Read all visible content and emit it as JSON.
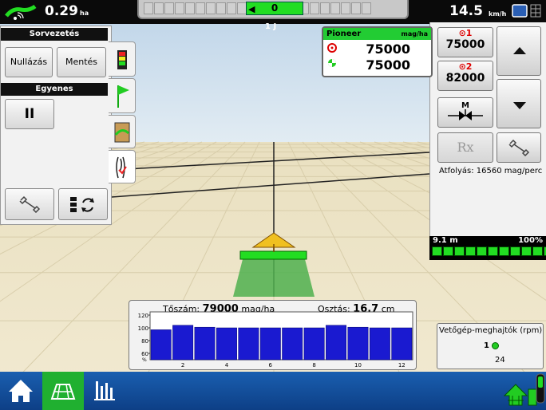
{
  "topbar": {
    "area_value": "0.29",
    "area_unit": "ha",
    "guidance_offset": "0",
    "pass_number": "1 J",
    "speed_value": "14.5",
    "speed_unit": "km/h"
  },
  "steering_panel": {
    "header": "Sorvezetés",
    "reset_label": "Nullázás",
    "save_label": "Mentés",
    "pattern_header": "Egyenes",
    "pause_label": "II"
  },
  "tabs": [
    "lightbar-tab-icon",
    "flag-tab-icon",
    "field-tab-icon",
    "steering-tab-icon"
  ],
  "product": {
    "name": "Pioneer",
    "unit": "mag/ha",
    "target_rate": "75000",
    "actual_rate": "75000"
  },
  "rate_presets": [
    {
      "label": "⊙1",
      "value": "75000"
    },
    {
      "label": "⊙2",
      "value": "82000"
    }
  ],
  "manual_label": "M",
  "rx_label": "Rx",
  "flow": "Átfolyás: 16560 mag/perc",
  "boom": {
    "width": "9.1 m",
    "percent": "100%",
    "sections": 12
  },
  "population_chart": {
    "population_label": "Tőszám:",
    "population_value": "79000",
    "population_unit": "mag/ha",
    "spacing_label": "Osztás:",
    "spacing_value": "16.7",
    "spacing_unit": "cm",
    "y_ticks": [
      "120",
      "100",
      "80",
      "60"
    ],
    "y_unit": "%",
    "x_ticks": [
      "2",
      "4",
      "6",
      "8",
      "10",
      "12"
    ],
    "values": [
      97,
      104,
      101,
      100,
      100,
      100,
      100,
      100,
      104,
      101,
      100,
      100
    ]
  },
  "drives": {
    "title": "Vetőgép-meghajtók (rpm)",
    "row": "1",
    "rpm": "24"
  },
  "nav": {
    "items": [
      "home-icon",
      "field-grid-icon",
      "chart-icon"
    ]
  },
  "colors": {
    "accent_green": "#22dd22",
    "nav_blue": "#0d3f86",
    "ground": "#ece3c5",
    "sky": "#cfe0ee"
  }
}
